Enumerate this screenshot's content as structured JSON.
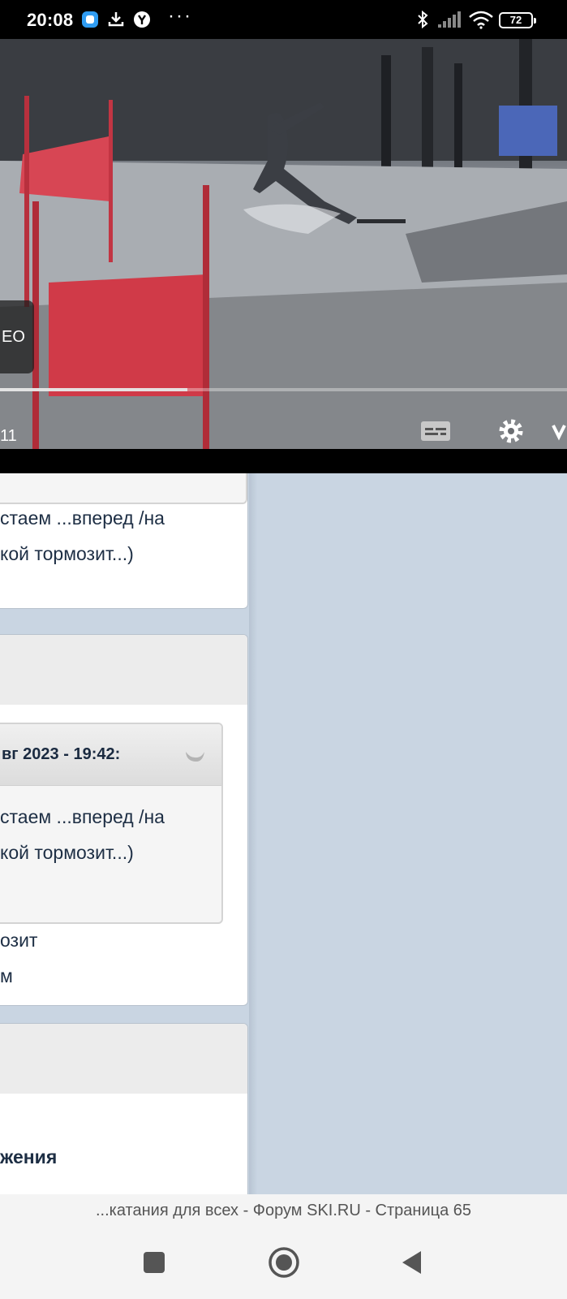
{
  "status_bar": {
    "time": "20:08",
    "icons": [
      "app-notification-icon",
      "download-icon",
      "yandex-browser-icon",
      "more-dots-icon",
      "bluetooth-icon",
      "signal-icon",
      "wifi-icon",
      "battery-icon"
    ],
    "more": "···",
    "battery": "72"
  },
  "video": {
    "overlay_label": "EO",
    "elapsed": "11",
    "progress_percent": 33,
    "controls": [
      "captions-icon",
      "settings-gear-icon",
      "youtube-logo-icon"
    ]
  },
  "forum": {
    "post1": {
      "lines": [
        "стаем ...вперед /на",
        "кой тормозит...)"
      ]
    },
    "post2": {
      "quote_header": "вг 2023 - 19:42:",
      "quote_lines": [
        "стаем ...вперед /на",
        "кой тормозит...)"
      ],
      "lines": [
        "озит",
        "м"
      ]
    },
    "post3": {
      "heading": "жения"
    }
  },
  "url_bar": {
    "title": "...катания для всех - Форум SKI.RU - Страница 65"
  },
  "nav": [
    "recent-apps-button",
    "home-button",
    "back-button"
  ]
}
